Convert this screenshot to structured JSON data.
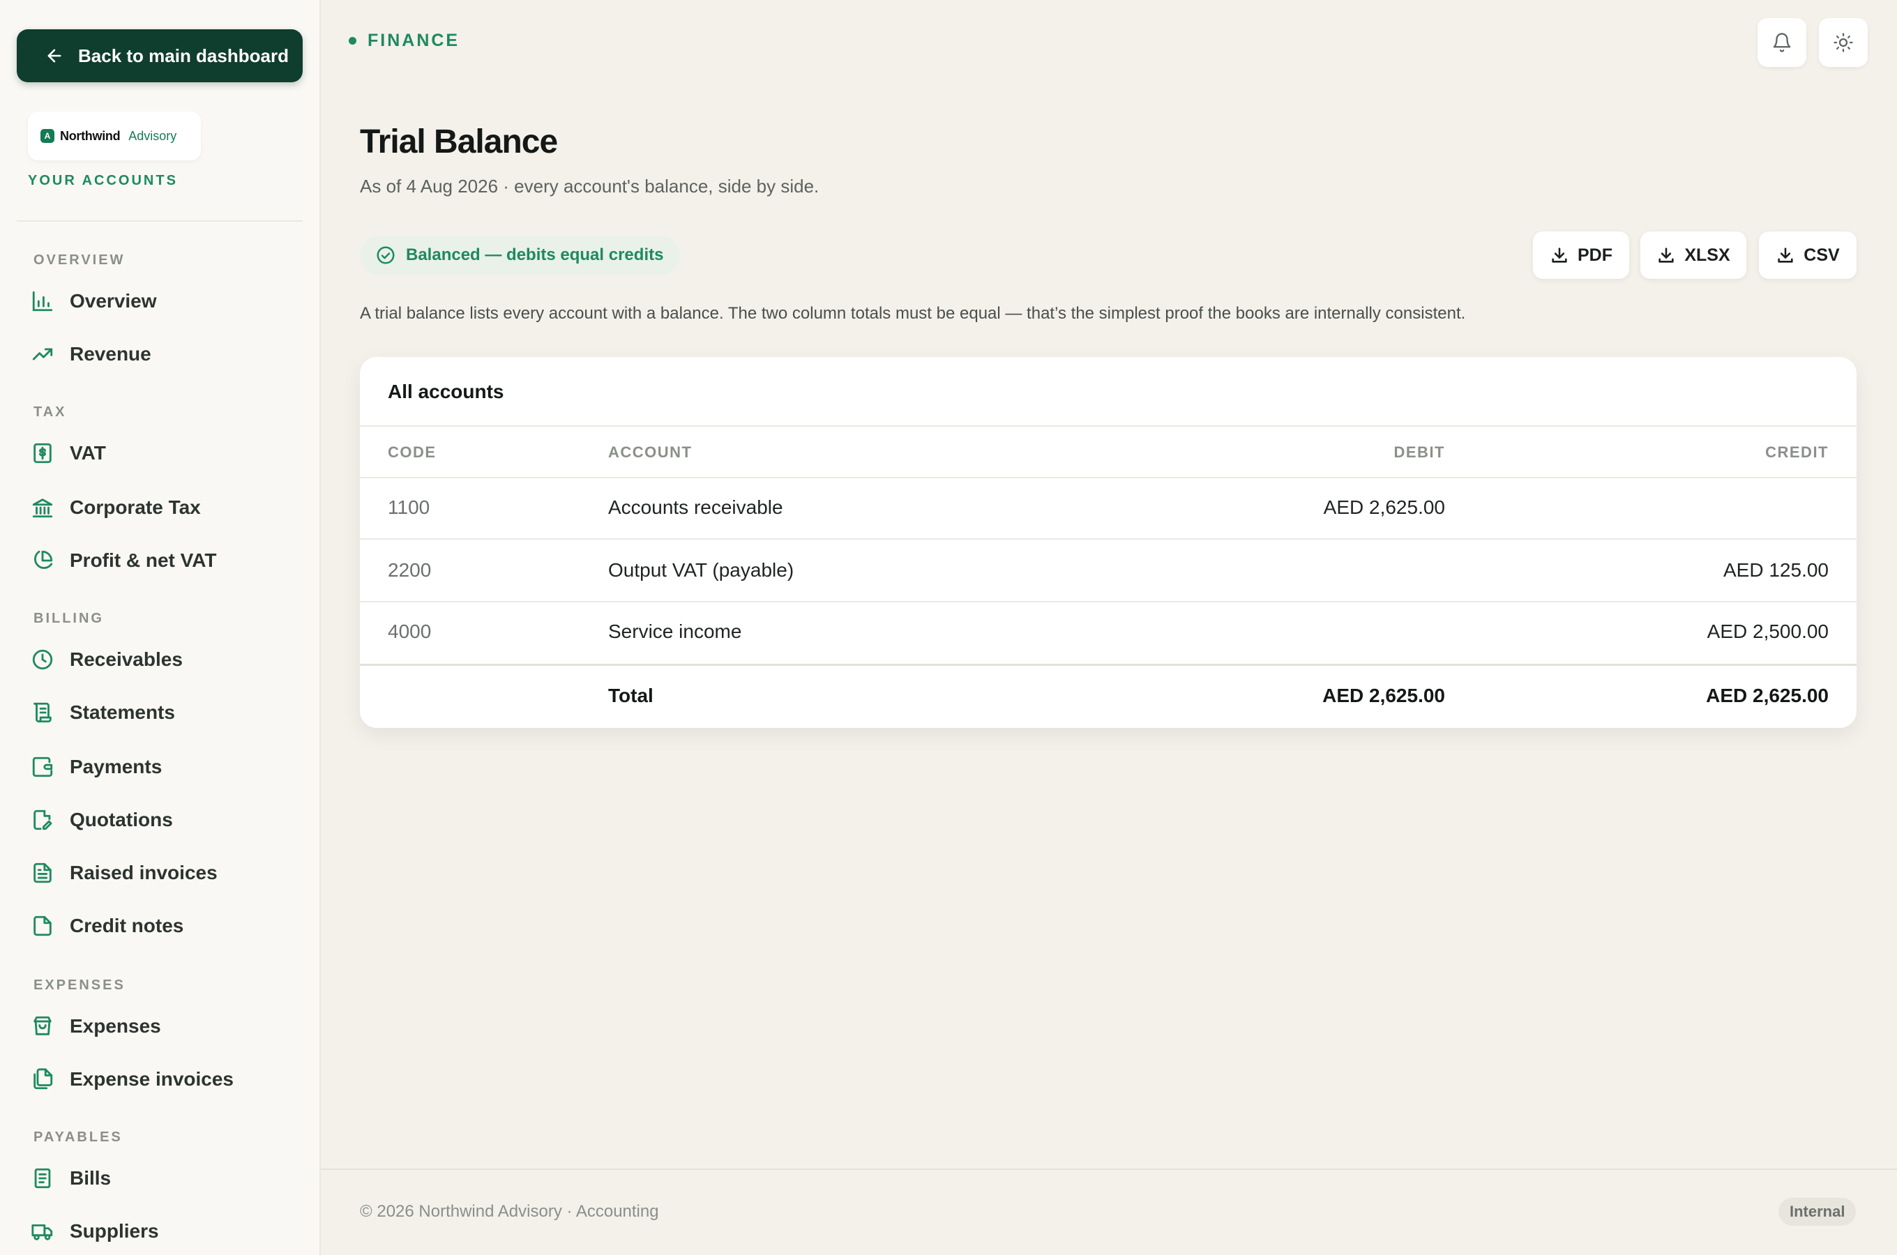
{
  "sidebar": {
    "back_label": "Back to main dashboard",
    "logo": {
      "mark": "A",
      "name": "Northwind",
      "sub": "Advisory"
    },
    "accounts_label": "YOUR ACCOUNTS",
    "sections": [
      {
        "title": "OVERVIEW",
        "items": [
          {
            "label": "Overview",
            "icon": "bar-chart-icon"
          },
          {
            "label": "Revenue",
            "icon": "trend-up-icon"
          }
        ]
      },
      {
        "title": "TAX",
        "items": [
          {
            "label": "VAT",
            "icon": "receipt-dollar-icon"
          },
          {
            "label": "Corporate Tax",
            "icon": "bank-icon"
          },
          {
            "label": "Profit & net VAT",
            "icon": "pie-chart-icon"
          }
        ]
      },
      {
        "title": "BILLING",
        "items": [
          {
            "label": "Receivables",
            "icon": "clock-icon"
          },
          {
            "label": "Statements",
            "icon": "scroll-icon"
          },
          {
            "label": "Payments",
            "icon": "wallet-icon"
          },
          {
            "label": "Quotations",
            "icon": "file-edit-icon"
          },
          {
            "label": "Raised invoices",
            "icon": "file-text-icon"
          },
          {
            "label": "Credit notes",
            "icon": "file-icon"
          }
        ]
      },
      {
        "title": "EXPENSES",
        "items": [
          {
            "label": "Expenses",
            "icon": "shopping-bag-icon"
          },
          {
            "label": "Expense invoices",
            "icon": "files-icon"
          }
        ]
      },
      {
        "title": "PAYABLES",
        "items": [
          {
            "label": "Bills",
            "icon": "receipt-icon"
          },
          {
            "label": "Suppliers",
            "icon": "truck-icon"
          }
        ]
      }
    ]
  },
  "header": {
    "crumb": "FINANCE"
  },
  "page": {
    "title": "Trial Balance",
    "subtitle": "As of 4 Aug 2026 · every account's balance, side by side.",
    "badge": "Balanced — debits equal credits",
    "exports": [
      "PDF",
      "XLSX",
      "CSV"
    ],
    "description": "A trial balance lists every account with a balance. The two column totals must be equal — that’s the simplest proof the books are internally consistent."
  },
  "table": {
    "title": "All accounts",
    "headers": {
      "code": "CODE",
      "account": "ACCOUNT",
      "debit": "DEBIT",
      "credit": "CREDIT"
    },
    "rows": [
      {
        "code": "1100",
        "account": "Accounts receivable",
        "debit": "AED 2,625.00",
        "credit": ""
      },
      {
        "code": "2200",
        "account": "Output VAT (payable)",
        "debit": "",
        "credit": "AED 125.00"
      },
      {
        "code": "4000",
        "account": "Service income",
        "debit": "",
        "credit": "AED 2,500.00"
      }
    ],
    "total": {
      "label": "Total",
      "debit": "AED 2,625.00",
      "credit": "AED 2,625.00"
    }
  },
  "footer": {
    "text": "© 2026 Northwind Advisory · Accounting",
    "pill": "Internal"
  },
  "colors": {
    "accent": "#1d8a5f",
    "primary_dark": "#0f3d2e"
  }
}
